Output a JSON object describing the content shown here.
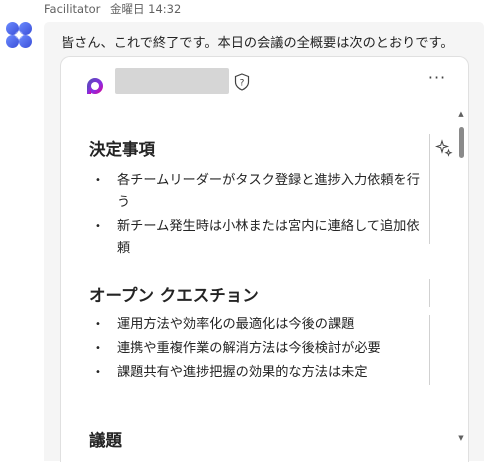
{
  "message": {
    "sender": "Facilitator",
    "timestamp": "金曜日 14:32",
    "intro_text": "皆さん、これで終了です。本日の会議の全概要は次のとおりです。"
  },
  "card": {
    "more_options": "···",
    "sections": [
      {
        "heading": "決定事項",
        "items": [
          "各チームリーダーがタスク登録と進捗入力依頼を行う",
          "新チーム発生時は小林または宮内に連絡して追加依頼"
        ]
      },
      {
        "heading": "オープン クエスチョン",
        "items": [
          "運用方法や効率化の最適化は今後の課題",
          "連携や重複作業の解消方法は今後検討が必要",
          "課題共有や進捗把握の効果的な方法は未定"
        ]
      }
    ],
    "next_heading_partial": "議題"
  },
  "icons": {
    "avatar": "copilot-facilitator-icon",
    "logo": "loop-logo-icon",
    "help": "shield-question-icon",
    "sparkle": "sparkle-icon",
    "more": "more-horizontal-icon"
  },
  "colors": {
    "logo_gradient_start": "#4f52b2",
    "logo_gradient_end": "#e3008c",
    "avatar_blue": "#4a6cf7"
  }
}
